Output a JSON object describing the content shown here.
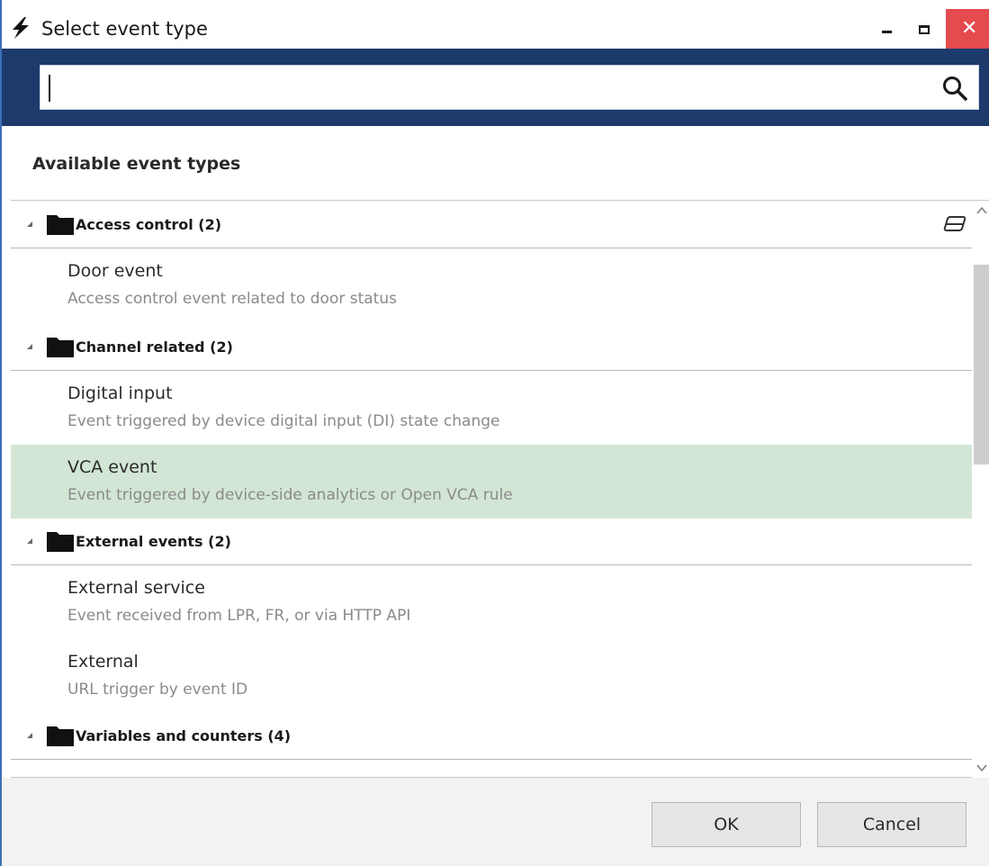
{
  "window": {
    "title": "Select event type"
  },
  "search": {
    "value": "",
    "placeholder": ""
  },
  "panel": {
    "section_title": "Available event types"
  },
  "groups": [
    {
      "label": "Access control (2)",
      "items": [
        {
          "name": "Door event",
          "description": "Access control event related to door status"
        }
      ]
    },
    {
      "label": "Channel related (2)",
      "items": [
        {
          "name": "Digital input",
          "description": "Event triggered by device digital input (DI) state change"
        },
        {
          "name": "VCA event",
          "description": "Event triggered by device-side analytics or Open VCA rule",
          "selected": true
        }
      ]
    },
    {
      "label": "External events (2)",
      "items": [
        {
          "name": "External service",
          "description": "Event received from LPR, FR, or via HTTP API"
        },
        {
          "name": "External",
          "description": "URL trigger by event ID"
        }
      ]
    },
    {
      "label": "Variables and counters (4)",
      "items": []
    }
  ],
  "footer": {
    "ok_label": "OK",
    "cancel_label": "Cancel"
  },
  "colors": {
    "search_band": "#1c3a6c",
    "selected_row": "#d3e6d5",
    "close_button": "#e44b4e"
  }
}
